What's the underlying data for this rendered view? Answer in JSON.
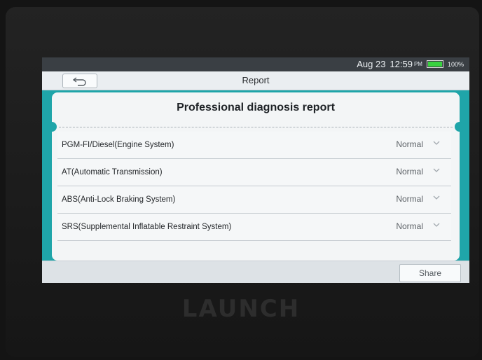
{
  "status_bar": {
    "date": "Aug 23",
    "time": "12:59",
    "ampm": "PM",
    "battery": "100%",
    "battery_level": 1.0,
    "battery_color": "#38d13f"
  },
  "header": {
    "title": "Report",
    "back_icon": "back-arrow-icon"
  },
  "report": {
    "heading": "Professional diagnosis report",
    "rows": [
      {
        "system": "PGM-FI/Diesel(Engine System)",
        "status": "Normal"
      },
      {
        "system": "AT(Automatic Transmission)",
        "status": "Normal"
      },
      {
        "system": "ABS(Anti-Lock Braking System)",
        "status": "Normal"
      },
      {
        "system": "SRS(Supplemental Inflatable Restraint System)",
        "status": "Normal"
      }
    ]
  },
  "footer": {
    "share_label": "Share"
  },
  "device": {
    "brand": "LAUNCH"
  },
  "colors": {
    "accent": "#1fa5a9"
  }
}
